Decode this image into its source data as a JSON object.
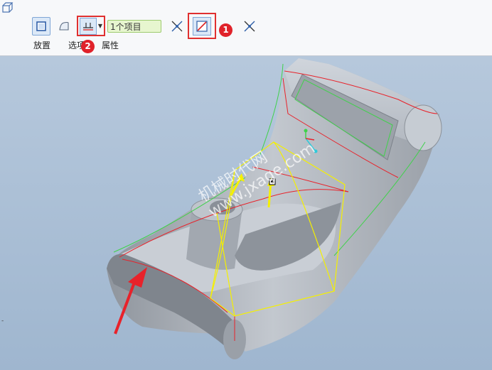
{
  "toolbar": {
    "reference_box_value": "1个项目",
    "tabs": [
      "放置",
      "选项",
      "属性"
    ]
  },
  "annotations": {
    "badge_1": "1",
    "badge_2": "2"
  },
  "viewport": {
    "watermark_line1": "机械时代网",
    "watermark_line2": "www.jxage.com",
    "left_tick": "-"
  },
  "colors": {
    "highlight_box": "#e03030",
    "badge": "#e0222a",
    "reference_box_bg": "#e7f6cf",
    "preview_yellow": "#f5f000",
    "edge_red": "#e8222a",
    "edge_green": "#3fd24a",
    "model_gray": "#a9afb8"
  },
  "icons": [
    "app-corner-icon",
    "placement-icon",
    "surface-icon",
    "thicken-icon",
    "flip-direction-icon",
    "trim-icon",
    "flip-direction-icon"
  ]
}
